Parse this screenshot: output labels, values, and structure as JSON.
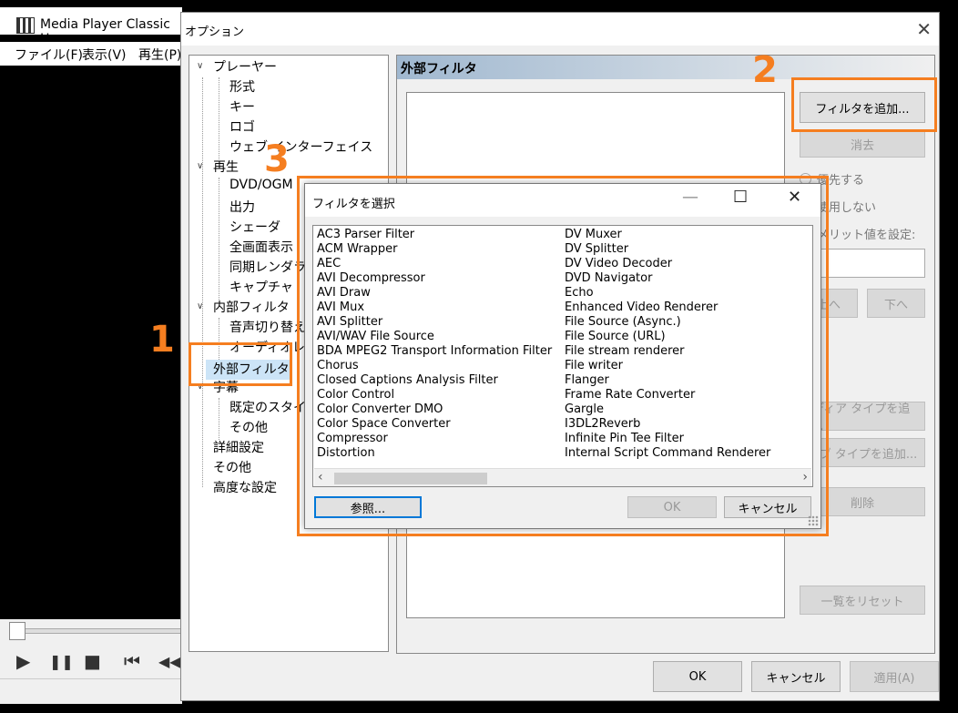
{
  "player": {
    "title": "Media Player Classic Ho",
    "menu": [
      "ファイル(F)",
      "表示(V)",
      "再生(P)"
    ],
    "controls": [
      "▶",
      "❚❚",
      "■",
      "⏮",
      "◀◀"
    ]
  },
  "options": {
    "title": "オプション",
    "close": "✕",
    "tree": [
      {
        "label": "プレーヤー",
        "level": 0,
        "expander": "∨"
      },
      {
        "label": "形式",
        "level": 1
      },
      {
        "label": "キー",
        "level": 1
      },
      {
        "label": "ロゴ",
        "level": 1
      },
      {
        "label": "ウェブ インターフェイス",
        "level": 1
      },
      {
        "label": "再生",
        "level": 0,
        "expander": "∨"
      },
      {
        "label": "DVD/OGM",
        "level": 1
      },
      {
        "label": "出力",
        "level": 1
      },
      {
        "label": "シェーダ",
        "level": 1
      },
      {
        "label": "全画面表示",
        "level": 1
      },
      {
        "label": "同期レンダラ",
        "level": 1
      },
      {
        "label": "キャプチャ",
        "level": 1
      },
      {
        "label": "内部フィルタ",
        "level": 0,
        "expander": "∨"
      },
      {
        "label": "音声切り替え",
        "level": 1
      },
      {
        "label": "オーディオレン",
        "level": 1
      },
      {
        "label": "外部フィルタ",
        "level": 0,
        "selected": true
      },
      {
        "label": "字幕",
        "level": 0,
        "expander": "∨"
      },
      {
        "label": "既定のスタイル",
        "level": 1
      },
      {
        "label": "その他",
        "level": 1
      },
      {
        "label": "詳細設定",
        "level": 0
      },
      {
        "label": "その他",
        "level": 0
      },
      {
        "label": "高度な設定",
        "level": 0
      }
    ],
    "page_title": "外部フィルタ",
    "add_filter": "フィルタを追加...",
    "remove": "消去",
    "prefer": "優先する",
    "block": "使用しない",
    "merit": "メリット値を設定:",
    "up": "上へ",
    "down": "下へ",
    "add_media_type": "メディア タイプを追加...",
    "add_sub_type": "サブ タイプを追加...",
    "delete": "削除",
    "reset_list": "一覧をリセット",
    "ok": "OK",
    "cancel": "キャンセル",
    "apply": "適用(A)"
  },
  "filter_dialog": {
    "title": "フィルタを選択",
    "minimize": "—",
    "maximize": "☐",
    "close": "✕",
    "col1": [
      "AC3 Parser Filter",
      "ACM Wrapper",
      "AEC",
      "AVI Decompressor",
      "AVI Draw",
      "AVI Mux",
      "AVI Splitter",
      "AVI/WAV File Source",
      "BDA MPEG2 Transport Information Filter",
      "Chorus",
      "Closed Captions Analysis Filter",
      "Color Control",
      "Color Converter DMO",
      "Color Space Converter",
      "Compressor",
      "Distortion"
    ],
    "col2": [
      "DV Muxer",
      "DV Splitter",
      "DV Video Decoder",
      "DVD Navigator",
      "Echo",
      "Enhanced Video Renderer",
      "File Source (Async.)",
      "File Source (URL)",
      "File stream renderer",
      "File writer",
      "Flanger",
      "Frame Rate Converter",
      "Gargle",
      "I3DL2Reverb",
      "Infinite Pin Tee Filter",
      "Internal Script Command Renderer"
    ],
    "browse": "参照...",
    "ok": "OK",
    "cancel": "キャンセル"
  },
  "annotations": {
    "n1": "1",
    "n2": "2",
    "n3": "3",
    "color": "#f57e20"
  }
}
